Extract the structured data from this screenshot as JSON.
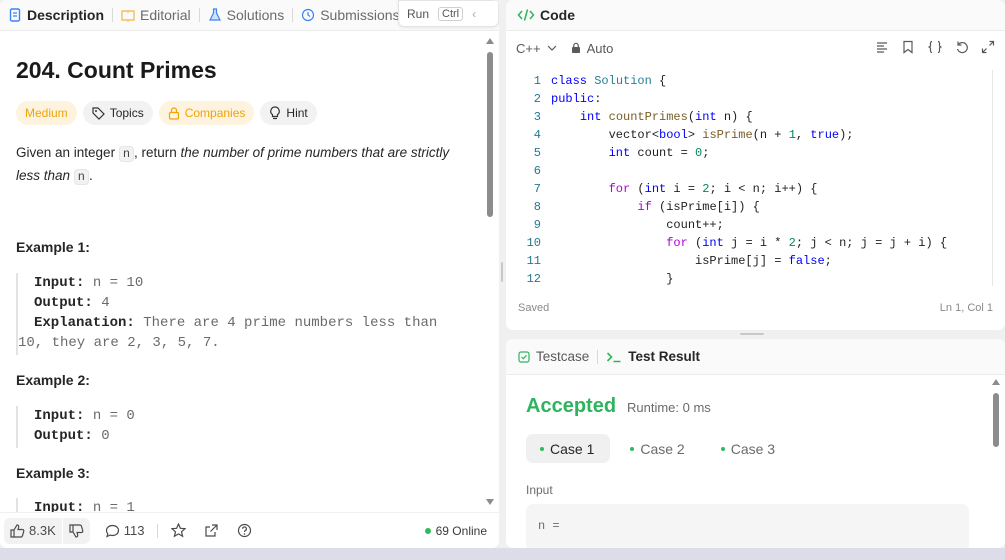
{
  "tabs": [
    {
      "label": "Description",
      "icon": "document-icon"
    },
    {
      "label": "Editorial",
      "icon": "book-icon"
    },
    {
      "label": "Solutions",
      "icon": "flask-icon"
    },
    {
      "label": "Submissions",
      "icon": "history-icon"
    }
  ],
  "floating": {
    "run_label": "Run",
    "kbd_label": "Ctrl"
  },
  "problem": {
    "title": "204. Count Primes",
    "difficulty": "Medium",
    "topics_label": "Topics",
    "companies_label": "Companies",
    "hint_label": "Hint",
    "statement_pre": "Given an integer ",
    "statement_code1": "n",
    "statement_mid": ", return ",
    "statement_em": "the number of prime numbers that are strictly less than ",
    "statement_code2": "n",
    "statement_post": "."
  },
  "examples": [
    {
      "title": "Example 1:",
      "input_label": "Input:",
      "input": "n = 10",
      "output_label": "Output:",
      "output": "4",
      "expl_label": "Explanation:",
      "expl_line1": "There are 4 prime numbers less than",
      "expl_line2": "10, they are 2, 3, 5, 7."
    },
    {
      "title": "Example 2:",
      "input_label": "Input:",
      "input": "n = 0",
      "output_label": "Output:",
      "output": "0"
    },
    {
      "title": "Example 3:",
      "input_label": "Input:",
      "input": "n = 1"
    }
  ],
  "footer": {
    "likes": "8.3K",
    "comments": "113",
    "online": "69 Online"
  },
  "code": {
    "header": "Code",
    "language": "C++",
    "auto_label": "Auto",
    "saved": "Saved",
    "cursor": "Ln 1, Col 1",
    "line_numbers": [
      "1",
      "2",
      "3",
      "4",
      "5",
      "6",
      "7",
      "8",
      "9",
      "10",
      "11",
      "12"
    ]
  },
  "test": {
    "testcase_label": "Testcase",
    "result_label": "Test Result",
    "status": "Accepted",
    "runtime": "Runtime: 0 ms",
    "cases": [
      "Case 1",
      "Case 2",
      "Case 3"
    ],
    "input_label": "Input",
    "input_value": "n ="
  },
  "colors": {
    "accent_green": "#2db55d",
    "medium": "#f0a40a",
    "line_number": "#237893"
  }
}
